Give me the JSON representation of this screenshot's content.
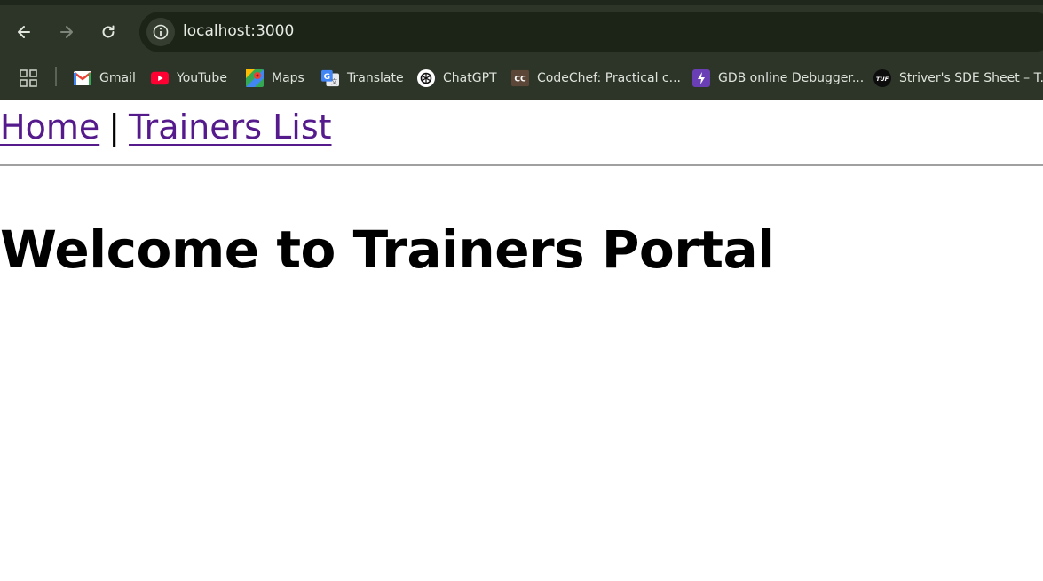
{
  "browser": {
    "url": "localhost:3000",
    "bookmarks": [
      {
        "label": "Gmail",
        "icon": "gmail-icon"
      },
      {
        "label": "YouTube",
        "icon": "youtube-icon"
      },
      {
        "label": "Maps",
        "icon": "maps-icon"
      },
      {
        "label": "Translate",
        "icon": "translate-icon"
      },
      {
        "label": "ChatGPT",
        "icon": "chatgpt-icon"
      },
      {
        "label": "CodeChef: Practical c...",
        "icon": "codechef-icon"
      },
      {
        "label": "GDB online Debugger...",
        "icon": "gdb-icon"
      },
      {
        "label": "Striver's SDE Sheet – T...",
        "icon": "tuf-icon"
      }
    ],
    "colors": {
      "toolbar": "#2c3527",
      "omnibox": "#1c2418"
    }
  },
  "page": {
    "nav": {
      "home": "Home",
      "separator": "|",
      "trainers": "Trainers List"
    },
    "heading": "Welcome to Trainers Portal",
    "link_color": "#551a8b"
  }
}
